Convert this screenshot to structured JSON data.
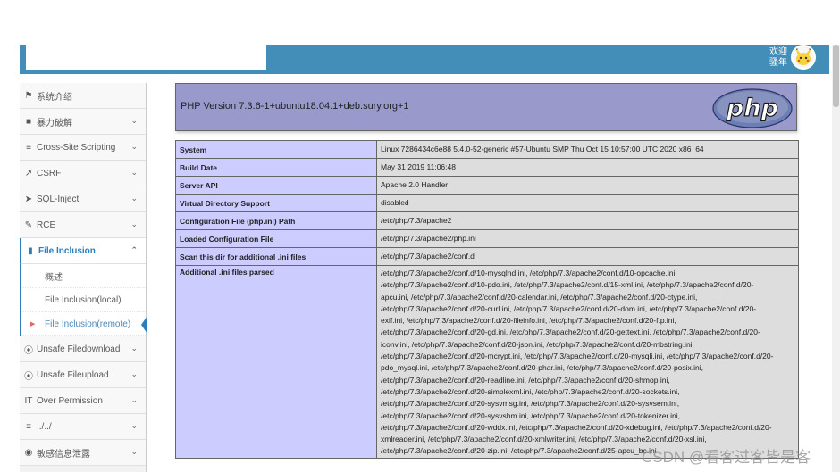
{
  "header": {
    "welcome_line1": "欢迎",
    "welcome_line2": "骚年"
  },
  "sidebar": {
    "items": [
      {
        "label": "系统介绍",
        "icon": "tag-icon"
      },
      {
        "label": "暴力破解",
        "icon": "lock-icon"
      },
      {
        "label": "Cross-Site Scripting",
        "icon": "sliders-icon"
      },
      {
        "label": "CSRF",
        "icon": "share-icon"
      },
      {
        "label": "SQL-Inject",
        "icon": "plane-icon"
      },
      {
        "label": "RCE",
        "icon": "pencil-icon"
      },
      {
        "label": "File Inclusion",
        "icon": "file-icon"
      },
      {
        "label": "Unsafe Filedownload",
        "icon": "circle-arrow-down-icon"
      },
      {
        "label": "Unsafe Fileupload",
        "icon": "circle-arrow-up-icon"
      },
      {
        "label": "Over Permission",
        "icon": "text-cursor-icon"
      },
      {
        "label": "../../",
        "icon": "align-left-icon"
      },
      {
        "label": "敏感信息泄露",
        "icon": "camera-icon"
      }
    ],
    "file_inclusion_sub": [
      {
        "label": "概述"
      },
      {
        "label": "File Inclusion(local)"
      },
      {
        "label": "File Inclusion(remote)"
      }
    ]
  },
  "phpinfo": {
    "version": "PHP Version 7.3.6-1+ubuntu18.04.1+deb.sury.org+1",
    "logo_text": "php",
    "rows": [
      {
        "key": "System",
        "value": "Linux 7286434c6e88 5.4.0-52-generic #57-Ubuntu SMP Thu Oct 15 10:57:00 UTC 2020 x86_64"
      },
      {
        "key": "Build Date",
        "value": "May 31 2019 11:06:48"
      },
      {
        "key": "Server API",
        "value": "Apache 2.0 Handler"
      },
      {
        "key": "Virtual Directory Support",
        "value": "disabled"
      },
      {
        "key": "Configuration File (php.ini) Path",
        "value": "/etc/php/7.3/apache2"
      },
      {
        "key": "Loaded Configuration File",
        "value": "/etc/php/7.3/apache2/php.ini"
      },
      {
        "key": "Scan this dir for additional .ini files",
        "value": "/etc/php/7.3/apache2/conf.d"
      }
    ],
    "additional_key": "Additional .ini files parsed",
    "additional_lines": [
      "/etc/php/7.3/apache2/conf.d/10-mysqlnd.ini, /etc/php/7.3/apache2/conf.d/10-opcache.ini,",
      "/etc/php/7.3/apache2/conf.d/10-pdo.ini, /etc/php/7.3/apache2/conf.d/15-xml.ini, /etc/php/7.3/apache2/conf.d/20-",
      "apcu.ini, /etc/php/7.3/apache2/conf.d/20-calendar.ini, /etc/php/7.3/apache2/conf.d/20-ctype.ini,",
      "/etc/php/7.3/apache2/conf.d/20-curl.ini, /etc/php/7.3/apache2/conf.d/20-dom.ini, /etc/php/7.3/apache2/conf.d/20-",
      "exif.ini, /etc/php/7.3/apache2/conf.d/20-fileinfo.ini, /etc/php/7.3/apache2/conf.d/20-ftp.ini,",
      "/etc/php/7.3/apache2/conf.d/20-gd.ini, /etc/php/7.3/apache2/conf.d/20-gettext.ini, /etc/php/7.3/apache2/conf.d/20-",
      "iconv.ini, /etc/php/7.3/apache2/conf.d/20-json.ini, /etc/php/7.3/apache2/conf.d/20-mbstring.ini,",
      "/etc/php/7.3/apache2/conf.d/20-mcrypt.ini, /etc/php/7.3/apache2/conf.d/20-mysqli.ini, /etc/php/7.3/apache2/conf.d/20-",
      "pdo_mysql.ini, /etc/php/7.3/apache2/conf.d/20-phar.ini, /etc/php/7.3/apache2/conf.d/20-posix.ini,",
      "/etc/php/7.3/apache2/conf.d/20-readline.ini, /etc/php/7.3/apache2/conf.d/20-shmop.ini,",
      "/etc/php/7.3/apache2/conf.d/20-simplexml.ini, /etc/php/7.3/apache2/conf.d/20-sockets.ini,",
      "/etc/php/7.3/apache2/conf.d/20-sysvmsg.ini, /etc/php/7.3/apache2/conf.d/20-sysvsem.ini,",
      "/etc/php/7.3/apache2/conf.d/20-sysvshm.ini, /etc/php/7.3/apache2/conf.d/20-tokenizer.ini,",
      "/etc/php/7.3/apache2/conf.d/20-wddx.ini, /etc/php/7.3/apache2/conf.d/20-xdebug.ini, /etc/php/7.3/apache2/conf.d/20-",
      "xmlreader.ini, /etc/php/7.3/apache2/conf.d/20-xmlwriter.ini, /etc/php/7.3/apache2/conf.d/20-xsl.ini,",
      "/etc/php/7.3/apache2/conf.d/20-zip.ini, /etc/php/7.3/apache2/conf.d/25-apcu_bc.ini"
    ]
  },
  "watermark": "CSDN @看客过客皆是客"
}
